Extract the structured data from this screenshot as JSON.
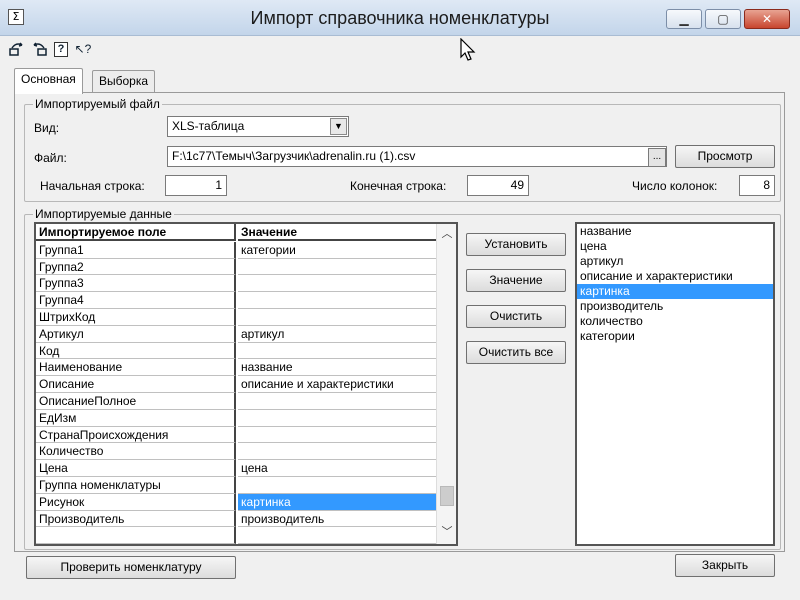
{
  "window": {
    "title": "Импорт справочника номенклатуры",
    "icon_glyph": "Σ",
    "controls": {
      "minimize": "▁",
      "maximize": "▢",
      "close": "✕"
    }
  },
  "toolbar": {
    "icons": [
      "import-icon",
      "export-icon",
      "help-icon",
      "context-help-icon"
    ],
    "help_glyph": "?",
    "context_help_glyph": "↖?"
  },
  "tabs": [
    {
      "label": "Основная",
      "active": true
    },
    {
      "label": "Выборка",
      "active": false
    }
  ],
  "import_file": {
    "legend": "Импортируемый файл",
    "type_label": "Вид:",
    "type_value": "XLS-таблица",
    "file_label": "Файл:",
    "file_value": "F:\\1c77\\Темыч\\Загрузчик\\adrenalin.ru (1).csv",
    "browse_label": "...",
    "view_button": "Просмотр",
    "start_row_label": "Начальная строка:",
    "start_row_value": "1",
    "end_row_label": "Конечная строка:",
    "end_row_value": "49",
    "column_count_label": "Число колонок:",
    "column_count_value": "8"
  },
  "imported_data": {
    "legend": "Импортируемые данные",
    "columns": [
      "Импортируемое поле",
      "Значение"
    ],
    "rows": [
      {
        "field": "Группа1",
        "value": "категории"
      },
      {
        "field": "Группа2",
        "value": ""
      },
      {
        "field": "Группа3",
        "value": ""
      },
      {
        "field": "Группа4",
        "value": ""
      },
      {
        "field": "ШтрихКод",
        "value": ""
      },
      {
        "field": "Артикул",
        "value": "артикул"
      },
      {
        "field": "Код",
        "value": ""
      },
      {
        "field": "Наименование",
        "value": "название"
      },
      {
        "field": "Описание",
        "value": "описание и характеристики"
      },
      {
        "field": "ОписаниеПолное",
        "value": ""
      },
      {
        "field": "ЕдИзм",
        "value": ""
      },
      {
        "field": "СтранаПроисхождения",
        "value": ""
      },
      {
        "field": "Количество",
        "value": ""
      },
      {
        "field": "Цена",
        "value": "цена"
      },
      {
        "field": "Группа номенклатуры",
        "value": ""
      },
      {
        "field": "Рисунок",
        "value": "картинка"
      },
      {
        "field": "Производитель",
        "value": "производитель"
      }
    ],
    "selected_row": 15
  },
  "action_buttons": {
    "set": "Установить",
    "value": "Значение",
    "clear": "Очистить",
    "clear_all": "Очистить все"
  },
  "source_columns": {
    "items": [
      "название",
      "цена",
      "артикул",
      "описание и характеристики",
      "картинка",
      "производитель",
      "количество",
      "категории"
    ],
    "selected_index": 4
  },
  "footer": {
    "check_button": "Проверить номенклатуру",
    "close_button": "Закрыть"
  },
  "colors": {
    "selection": "#3399ff",
    "close_button": "#c8452e"
  }
}
